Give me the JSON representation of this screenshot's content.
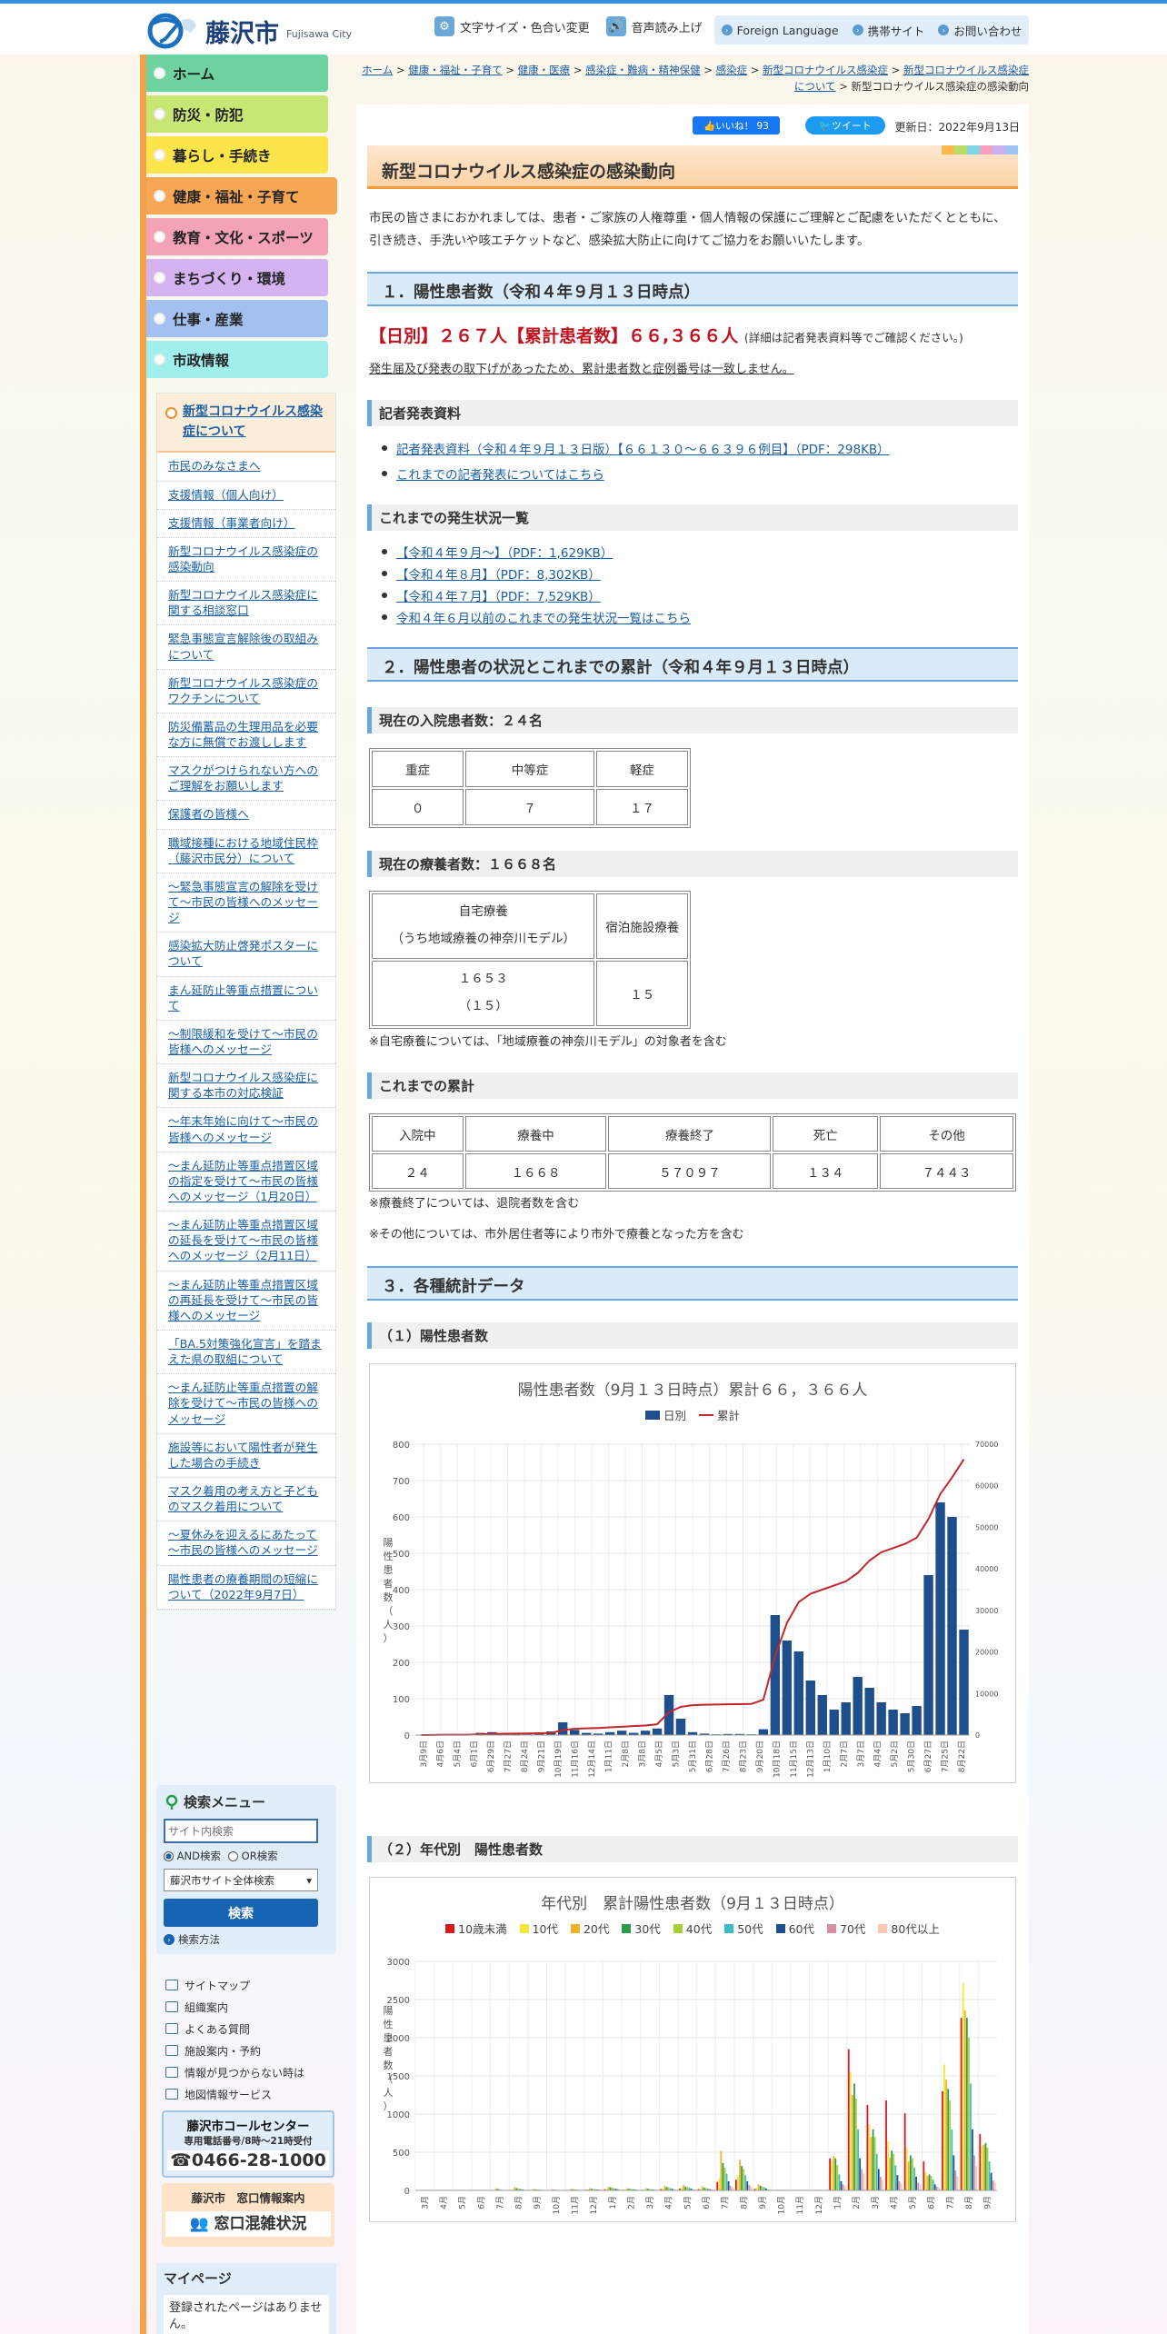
{
  "header": {
    "city_name": "藤沢市",
    "city_name_en": "Fujisawa City",
    "font_size_label": "文字サイズ・色合い変更",
    "voice_label": "音声読み上げ",
    "foreign_label": "Foreign Language",
    "mobile_label": "携帯サイト",
    "contact_label": "お問い合わせ"
  },
  "gnav": [
    {
      "label": "ホーム",
      "color": "#6dd3a0"
    },
    {
      "label": "防災・防犯",
      "color": "#c8e673"
    },
    {
      "label": "暮らし・手続き",
      "color": "#fbe54a"
    },
    {
      "label": "健康・福祉・子育て",
      "color": "#f7a654"
    },
    {
      "label": "教育・文化・スポーツ",
      "color": "#f4a2b6"
    },
    {
      "label": "まちづくり・環境",
      "color": "#d4b3f0"
    },
    {
      "label": "仕事・産業",
      "color": "#a2c0f0"
    },
    {
      "label": "市政情報",
      "color": "#a0efec"
    }
  ],
  "sidemenu": {
    "title": "新型コロナウイルス感染症について",
    "items": [
      "市民のみなさまへ",
      "支援情報（個人向け）",
      "支援情報（事業者向け）",
      "新型コロナウイルス感染症の感染動向",
      "新型コロナウイルス感染症に関する相談窓口",
      "緊急事態宣言解除後の取組みについて",
      "新型コロナウイルス感染症のワクチンについて",
      "防災備蓄品の生理用品を必要な方に無償でお渡しします",
      "マスクがつけられない方へのご理解をお願いします",
      "保護者の皆様へ",
      "職域接種における地域住民枠（藤沢市民分）について",
      "～緊急事態宣言の解除を受けて～市民の皆様へのメッセージ",
      "感染拡大防止啓発ポスターについて",
      "まん延防止等重点措置について",
      "～制限緩和を受けて～市民の皆様へのメッセージ",
      "新型コロナウイルス感染症に関する本市の対応検証",
      "～年末年始に向けて～市民の皆様へのメッセージ",
      "～まん延防止等重点措置区域の指定を受けて～市民の皆様へのメッセージ（1月20日）",
      "～まん延防止等重点措置区域の延長を受けて～市民の皆様へのメッセージ（2月11日）",
      "～まん延防止等重点措置区域の再延長を受けて～市民の皆様へのメッセージ",
      "「BA.5対策強化宣言」を踏まえた県の取組について",
      "～まん延防止等重点措置の解除を受けて～市民の皆様へのメッセージ",
      "施設等において陽性者が発生した場合の手続き",
      "マスク着用の考え方と子どものマスク着用について",
      "～夏休みを迎えるにあたって～市民の皆様へのメッセージ",
      "陽性患者の療養期間の短縮について（2022年9月7日）"
    ]
  },
  "search": {
    "title": "検索メニュー",
    "placeholder": "サイト内検索",
    "and_label": "AND検索",
    "or_label": "OR検索",
    "scope": "藤沢市サイト全体検索",
    "button": "検索",
    "how": "検索方法"
  },
  "sidelinks": [
    "サイトマップ",
    "組織案内",
    "よくある質問",
    "施設案内・予約",
    "情報が見つからない時は",
    "地図情報サービス"
  ],
  "callcenter": {
    "name": "藤沢市コールセンター",
    "sub": "専用電話番号/8時～21時受付",
    "tel": "0466-28-1000"
  },
  "window_info": {
    "name": "藤沢市　窓口情報案内",
    "button": "窓口混雑状況"
  },
  "mypage": {
    "title": "マイページ",
    "body": "登録されたページはありません。"
  },
  "breadcrumb": {
    "items": [
      "ホーム",
      "健康・福祉・子育て",
      "健康・医療",
      "感染症・難病・精神保健",
      "感染症",
      "新型コロナウイルス感染症",
      "新型コロナウイルス感染症について"
    ],
    "current": "新型コロナウイルス感染症の感染動向"
  },
  "social": {
    "like": "いいね！ 93",
    "tweet": "ツイート"
  },
  "update": "更新日：2022年9月13日",
  "page_title": "新型コロナウイルス感染症の感染動向",
  "intro": "市民の皆さまにおかれましては、患者・ご家族の人権尊重・個人情報の保護にご理解とご配慮をいただくとともに、引き続き、手洗いや咳エチケットなど、感染拡大防止に向けてご協力をお願いいたします。",
  "sec1": {
    "heading": "１．陽性患者数（令和４年９月１３日時点）",
    "headline": "【日別】２６７人【累計患者数】６６,３６６人",
    "headline_note": "(詳細は記者発表資料等でご確認ください。)",
    "note": "発生届及び発表の取下げがあったため、累計患者数と症例番号は一致しません。"
  },
  "press": {
    "heading": "記者発表資料",
    "items": [
      "記者発表資料（令和４年９月１３日版）【６６１３０～６６３９６例目】（PDF：298KB）",
      "これまでの記者発表についてはこちら"
    ]
  },
  "history": {
    "heading": "これまでの発生状況一覧",
    "items": [
      "【令和４年９月～】（PDF：1,629KB）",
      "【令和４年８月】（PDF：8,302KB）",
      "【令和４年７月】（PDF：7,529KB）",
      "令和４年６月以前のこれまでの発生状況一覧はこちら"
    ]
  },
  "sec2": {
    "heading": "２．陽性患者の状況とこれまでの累計（令和４年９月１３日時点）"
  },
  "hospital": {
    "heading": "現在の入院患者数：２４名",
    "headers": [
      "重症",
      "中等症",
      "軽症"
    ],
    "values": [
      "０",
      "７",
      "１７"
    ]
  },
  "recuperating": {
    "heading": "現在の療養者数：１６６８名",
    "h1": "自宅療養",
    "h1_sub": "（うち地域療養の神奈川モデル）",
    "h2": "宿泊施設療養",
    "v1": "１６５３",
    "v1_sub": "（１５）",
    "v2": "１５",
    "note": "※自宅療養については、「地域療養の神奈川モデル」の対象者を含む"
  },
  "cumulative": {
    "heading": "これまでの累計",
    "headers": [
      "入院中",
      "療養中",
      "療養終了",
      "死亡",
      "その他"
    ],
    "values": [
      "２４",
      "１６６８",
      "５７０９７",
      "１３４",
      "７４４３"
    ],
    "note1": "※療養終了については、退院者数を含む",
    "note2": "※その他については、市外居住者等により市外で療養となった方を含む"
  },
  "sec3": {
    "heading": "３．各種統計データ"
  },
  "stat1": {
    "heading": "（１）陽性患者数"
  },
  "stat2": {
    "heading": "（２）年代別　陽性患者数"
  },
  "chart_data": [
    {
      "type": "bar",
      "title": "陽性患者数（9月１３日時点）累計６６，３６６人",
      "ylabel": "陽性患者数（人）",
      "ylim": [
        0,
        800
      ],
      "y2lim": [
        0,
        70000
      ],
      "yticks": [
        0,
        100,
        200,
        300,
        400,
        500,
        600,
        700,
        800
      ],
      "y2ticks": [
        0,
        10000,
        20000,
        30000,
        40000,
        50000,
        60000,
        70000
      ],
      "categories": [
        "3月9日",
        "4月6日",
        "5月4日",
        "6月1日",
        "6月29日",
        "7月27日",
        "8月24日",
        "9月21日",
        "10月19日",
        "11月16日",
        "12月14日",
        "1月11日",
        "2月8日",
        "3月8日",
        "4月5日",
        "5月3日",
        "5月31日",
        "6月28日",
        "7月26日",
        "8月23日",
        "9月20日",
        "10月18日",
        "11月15日",
        "12月13日",
        "1月10日",
        "2月7日",
        "3月7日",
        "4月4日",
        "5月2日",
        "5月30日",
        "6月27日",
        "7月25日",
        "8月22日"
      ],
      "grid": true,
      "legend": "top",
      "series": [
        {
          "name": "日別",
          "type": "bar",
          "color": "#1f4e8c",
          "values": [
            1,
            1,
            2,
            1,
            0,
            6,
            8,
            5,
            3,
            2,
            6,
            10,
            35,
            14,
            6,
            4,
            8,
            12,
            6,
            12,
            18,
            110,
            45,
            8,
            4,
            2,
            3,
            3,
            2,
            16,
            330,
            260,
            230,
            150,
            110,
            70,
            90,
            160,
            130,
            90,
            70,
            60,
            80,
            440,
            640,
            600,
            290
          ]
        },
        {
          "name": "累計",
          "type": "line",
          "color": "#c1272d",
          "values": [
            0,
            40,
            70,
            80,
            90,
            180,
            260,
            320,
            350,
            380,
            430,
            500,
            1200,
            1500,
            1600,
            1700,
            1850,
            2000,
            2150,
            2300,
            2600,
            5500,
            6800,
            7200,
            7300,
            7350,
            7400,
            7450,
            7500,
            8500,
            19000,
            27000,
            32000,
            34000,
            35000,
            36000,
            37000,
            39000,
            42000,
            44000,
            45000,
            46000,
            47500,
            52000,
            58000,
            62000,
            66366
          ]
        }
      ]
    },
    {
      "type": "bar",
      "title": "年代別　累計陽性患者数（9月１３日時点）",
      "ylabel": "陽性患者数（人）",
      "ylim": [
        0,
        3000
      ],
      "yticks": [
        0,
        500,
        1000,
        1500,
        2000,
        2500,
        3000
      ],
      "categories": [
        "3月",
        "4月",
        "5月",
        "6月",
        "7月",
        "8月",
        "9月",
        "10月",
        "11月",
        "12月",
        "1月",
        "2月",
        "3月",
        "4月",
        "5月",
        "6月",
        "7月",
        "8月",
        "9月",
        "10月",
        "11月",
        "12月",
        "1月",
        "2月",
        "3月",
        "4月",
        "5月",
        "6月",
        "7月",
        "8月",
        "9月"
      ],
      "grid": true,
      "legend": "top",
      "series": [
        {
          "name": "10歳未満",
          "color": "#d7191c",
          "values": [
            0,
            2,
            0,
            0,
            2,
            6,
            4,
            4,
            6,
            10,
            15,
            8,
            8,
            18,
            25,
            16,
            110,
            140,
            20,
            4,
            2,
            4,
            420,
            1850,
            1120,
            1180,
            1010,
            380,
            1300,
            2260,
            740
          ]
        },
        {
          "name": "10代",
          "color": "#f2e83a",
          "values": [
            0,
            2,
            1,
            0,
            5,
            12,
            6,
            4,
            8,
            12,
            20,
            12,
            10,
            25,
            35,
            22,
            160,
            200,
            35,
            6,
            3,
            6,
            380,
            1550,
            870,
            640,
            560,
            240,
            1650,
            2720,
            580
          ]
        },
        {
          "name": "20代",
          "color": "#f0b323",
          "values": [
            0,
            3,
            2,
            0,
            30,
            45,
            20,
            15,
            20,
            30,
            50,
            30,
            30,
            60,
            70,
            50,
            520,
            400,
            80,
            10,
            5,
            8,
            450,
            1250,
            700,
            430,
            380,
            190,
            1450,
            2360,
            600
          ]
        },
        {
          "name": "30代",
          "color": "#2a9d48",
          "values": [
            0,
            2,
            1,
            0,
            20,
            30,
            14,
            10,
            15,
            22,
            40,
            22,
            22,
            45,
            50,
            35,
            360,
            320,
            60,
            6,
            4,
            6,
            420,
            1400,
            800,
            520,
            460,
            210,
            1330,
            2260,
            620
          ]
        },
        {
          "name": "40代",
          "color": "#a9cf38",
          "values": [
            0,
            2,
            1,
            0,
            15,
            25,
            12,
            8,
            14,
            20,
            35,
            20,
            20,
            40,
            45,
            30,
            300,
            280,
            50,
            5,
            3,
            5,
            330,
            1200,
            700,
            480,
            420,
            190,
            1180,
            2000,
            560
          ]
        },
        {
          "name": "50代",
          "color": "#3bbdc8",
          "values": [
            0,
            1,
            1,
            0,
            10,
            20,
            10,
            7,
            10,
            15,
            28,
            16,
            15,
            30,
            35,
            25,
            220,
            200,
            40,
            4,
            2,
            4,
            210,
            800,
            480,
            330,
            300,
            140,
            800,
            1400,
            380
          ]
        },
        {
          "name": "60代",
          "color": "#1f4e8c",
          "values": [
            0,
            1,
            0,
            0,
            6,
            12,
            7,
            5,
            8,
            12,
            20,
            12,
            10,
            20,
            22,
            15,
            120,
            120,
            25,
            3,
            2,
            3,
            120,
            420,
            280,
            200,
            180,
            80,
            460,
            800,
            230
          ]
        },
        {
          "name": "70代",
          "color": "#d88f9f",
          "values": [
            0,
            1,
            0,
            0,
            4,
            8,
            5,
            4,
            6,
            10,
            18,
            10,
            8,
            14,
            16,
            10,
            60,
            70,
            14,
            2,
            1,
            2,
            80,
            280,
            180,
            120,
            100,
            50,
            260,
            460,
            130
          ]
        },
        {
          "name": "80代以上",
          "color": "#f7c9b2",
          "values": [
            0,
            0,
            0,
            0,
            3,
            6,
            4,
            3,
            5,
            8,
            15,
            8,
            6,
            10,
            12,
            8,
            40,
            50,
            10,
            1,
            1,
            2,
            60,
            220,
            140,
            90,
            80,
            40,
            180,
            320,
            100
          ]
        }
      ]
    }
  ]
}
